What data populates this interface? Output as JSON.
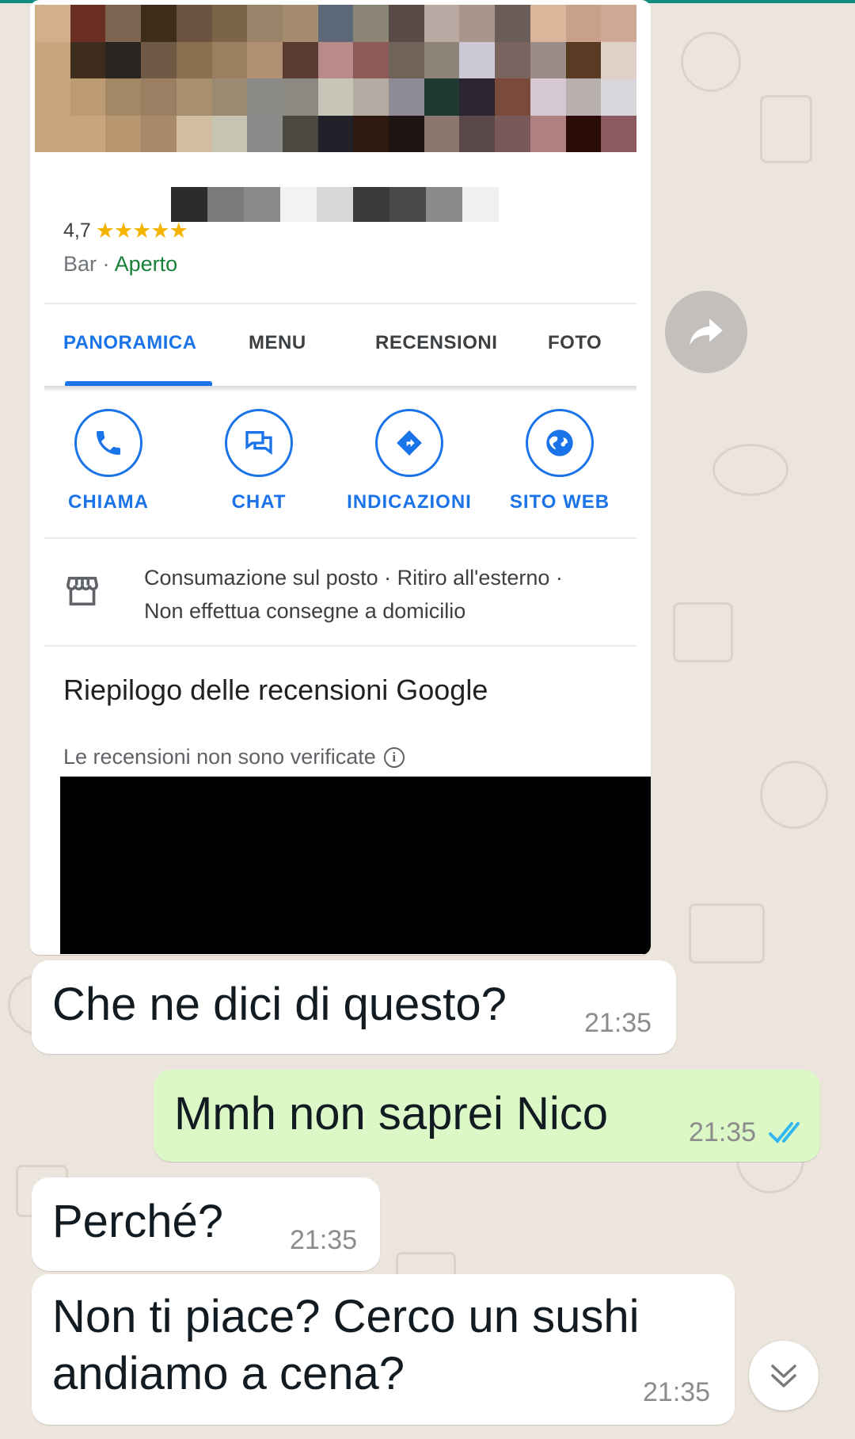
{
  "place": {
    "rating": "4,7",
    "stars": "★★★★★",
    "category": "Bar",
    "separator": "·",
    "status": "Aperto"
  },
  "tabs": [
    {
      "label": "PANORAMICA"
    },
    {
      "label": "MENU"
    },
    {
      "label": "RECENSIONI"
    },
    {
      "label": "FOTO"
    }
  ],
  "actions": [
    {
      "label": "CHIAMA",
      "icon": "phone-icon"
    },
    {
      "label": "CHAT",
      "icon": "chat-icon"
    },
    {
      "label": "INDICAZIONI",
      "icon": "directions-icon"
    },
    {
      "label": "SITO WEB",
      "icon": "globe-icon"
    }
  ],
  "services": {
    "line1": "Consumazione sul posto · Ritiro all'esterno ·",
    "line2": "Non effettua consegne a domicilio"
  },
  "reviews": {
    "title": "Riepilogo delle recensioni Google",
    "note": "Le recensioni non sono verificate",
    "info_glyph": "i"
  },
  "messages": [
    {
      "direction": "incoming",
      "text": "Che ne dici di questo?",
      "time": "21:35"
    },
    {
      "direction": "outgoing",
      "text": "Mmh non saprei Nico",
      "time": "21:35",
      "status": "read"
    },
    {
      "direction": "incoming",
      "text": "Perché?",
      "time": "21:35"
    },
    {
      "direction": "incoming",
      "text": "Non ti piace? Cerco un sushi\nandiamo a cena?",
      "time": "21:35"
    }
  ],
  "colors": {
    "accent": "#1a73e8",
    "open": "#188038",
    "outgoing_bubble": "#dcf8c6",
    "read_ticks": "#34b7f1"
  }
}
